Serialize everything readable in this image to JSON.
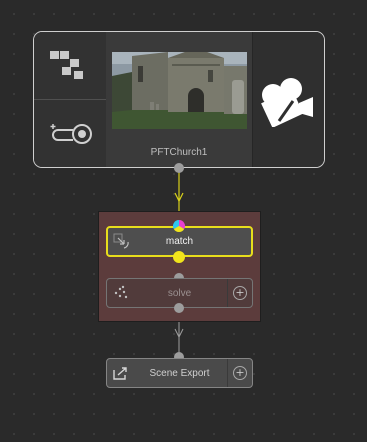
{
  "clip_node": {
    "name": "PFTChurch1"
  },
  "match_node": {
    "label": "match"
  },
  "solve_node": {
    "label": "solve"
  },
  "export_node": {
    "label": "Scene Export"
  },
  "colors": {
    "background": "#2a2a2a",
    "selected_outline": "#e8de1c",
    "group_fill": "#5c3c3c",
    "connector": "#9d9d9d"
  },
  "icons": {
    "clip_tiles": "tiles-icon",
    "clip_zoom": "zoom-icon",
    "clip_camera": "camera-icon",
    "match": "match-icon",
    "solve": "solve-icon",
    "export": "export-icon",
    "add": "plus-circle-icon"
  },
  "plus_symbol": "+"
}
